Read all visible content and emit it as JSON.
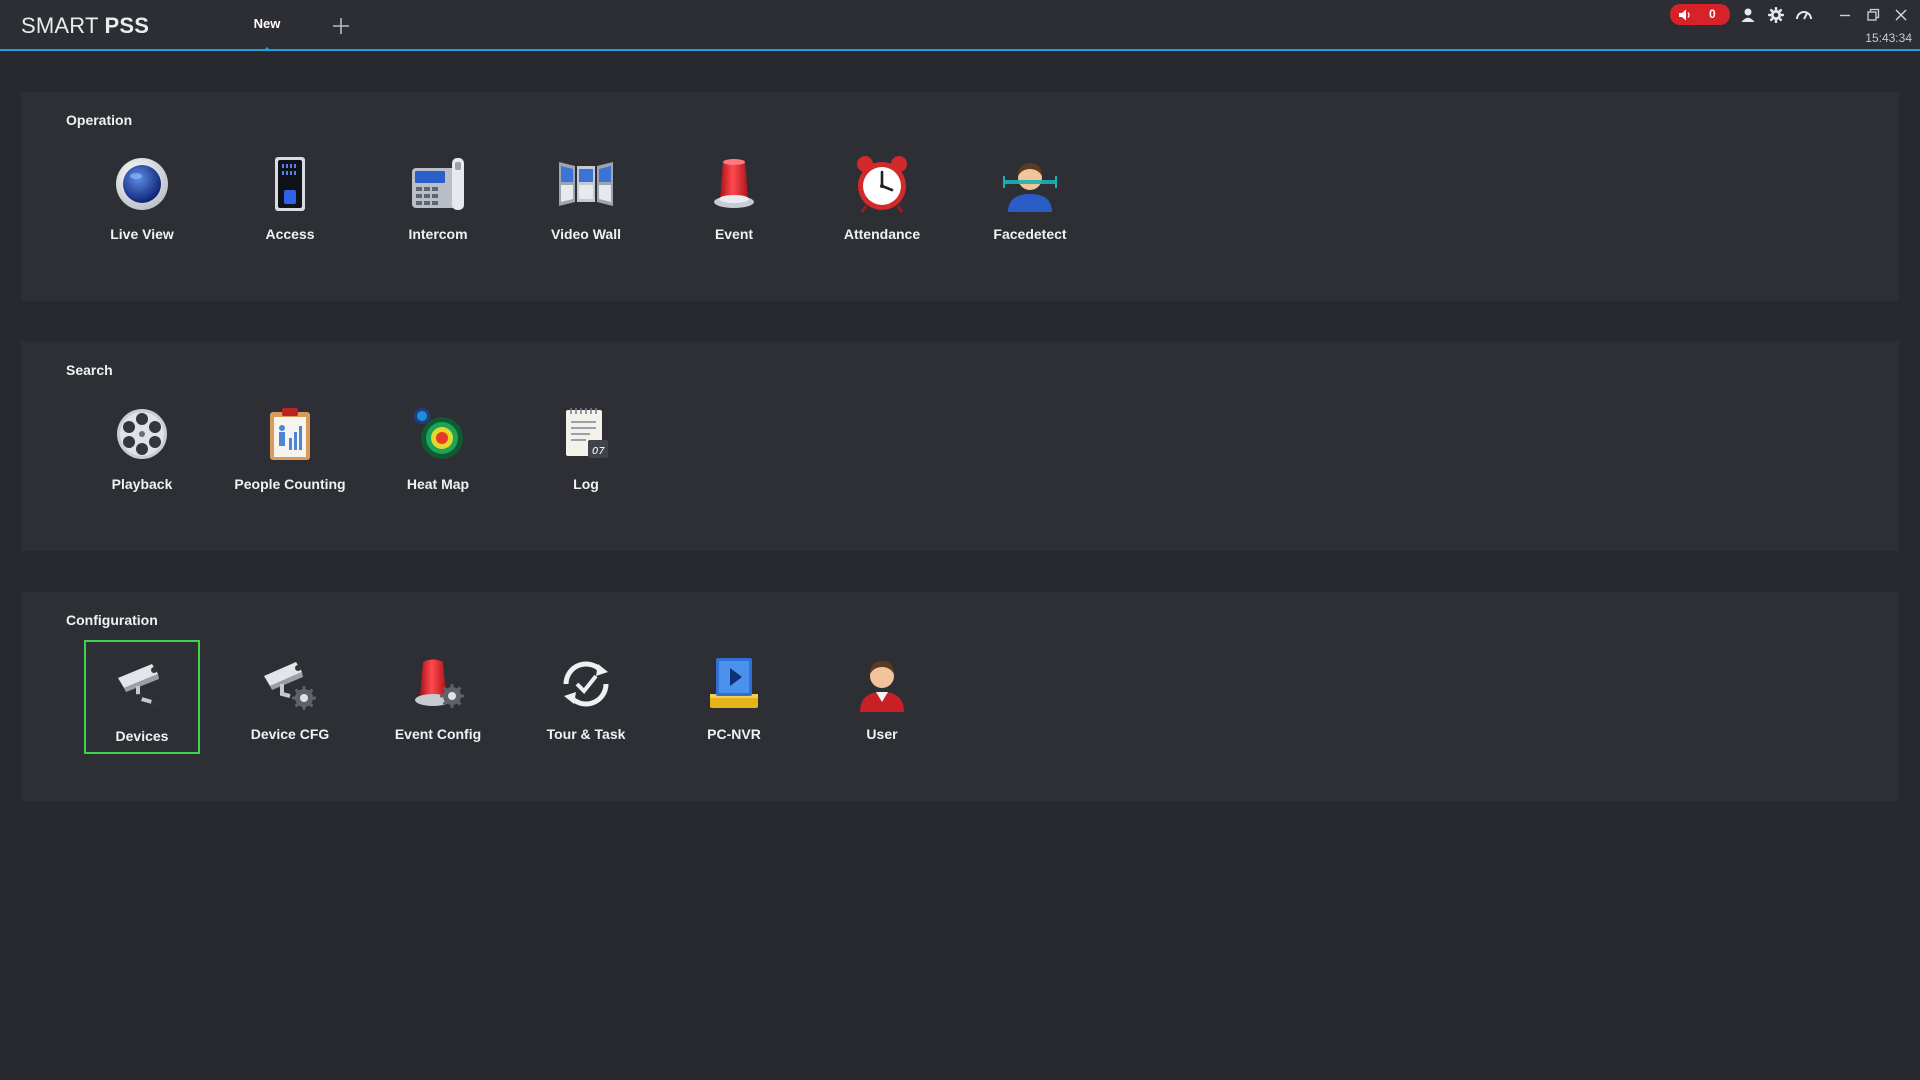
{
  "header": {
    "app_title_light": "SMART",
    "app_title_strong": "PSS",
    "tab_label": "New",
    "alarm_count": "0",
    "clock": "15:43:34",
    "icons": [
      "speaker-icon",
      "user-icon",
      "gear-icon",
      "speedometer-icon",
      "minimize-icon",
      "restore-icon",
      "close-icon"
    ],
    "accent_color": "#1aa3dc",
    "alarm_color": "#d8222a"
  },
  "sections": {
    "operation": {
      "title": "Operation",
      "items": [
        {
          "label": "Live View",
          "icon": "live-view-icon"
        },
        {
          "label": "Access",
          "icon": "access-icon"
        },
        {
          "label": "Intercom",
          "icon": "intercom-icon"
        },
        {
          "label": "Video Wall",
          "icon": "video-wall-icon"
        },
        {
          "label": "Event",
          "icon": "event-icon"
        },
        {
          "label": "Attendance",
          "icon": "attendance-icon"
        },
        {
          "label": "Facedetect",
          "icon": "facedetect-icon"
        }
      ]
    },
    "search": {
      "title": "Search",
      "items": [
        {
          "label": "Playback",
          "icon": "playback-icon"
        },
        {
          "label": "People Counting",
          "icon": "people-counting-icon"
        },
        {
          "label": "Heat Map",
          "icon": "heat-map-icon"
        },
        {
          "label": "Log",
          "icon": "log-icon"
        }
      ]
    },
    "configuration": {
      "title": "Configuration",
      "items": [
        {
          "label": "Devices",
          "icon": "devices-icon",
          "selected": true
        },
        {
          "label": "Device CFG",
          "icon": "device-cfg-icon"
        },
        {
          "label": "Event Config",
          "icon": "event-config-icon"
        },
        {
          "label": "Tour & Task",
          "icon": "tour-task-icon"
        },
        {
          "label": "PC-NVR",
          "icon": "pc-nvr-icon"
        },
        {
          "label": "User",
          "icon": "user-icon"
        }
      ]
    }
  },
  "selection_color": "#3dd34a"
}
